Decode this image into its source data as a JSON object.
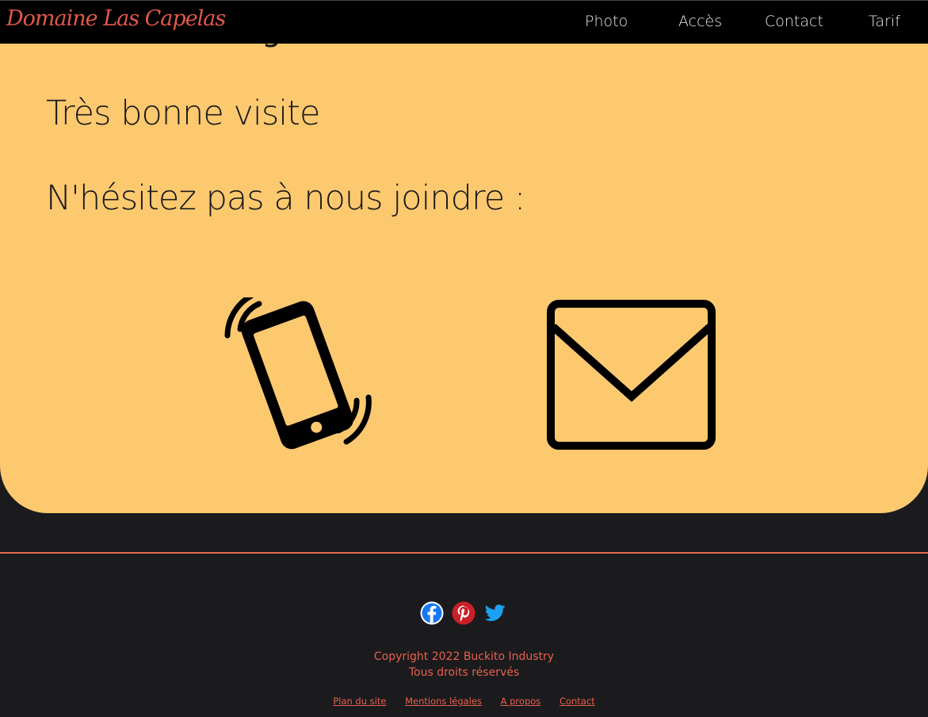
{
  "header": {
    "logo": "Domaine Las Capelas",
    "nav": [
      {
        "label": "Photo"
      },
      {
        "label": "Accès"
      },
      {
        "label": "Contact"
      },
      {
        "label": "Tarif"
      }
    ]
  },
  "content": {
    "line1": "Très bonne visite",
    "line2": "N'hésitez pas à nous joindre :",
    "icons": [
      "phone-vibrate-icon",
      "envelope-icon"
    ]
  },
  "footer": {
    "socials": [
      "facebook-icon",
      "pinterest-icon",
      "twitter-icon"
    ],
    "copyright_line1": "Copyright 2022 Buckito Industry",
    "copyright_line2": "Tous droits réservés",
    "links": [
      {
        "label": "Plan du site"
      },
      {
        "label": "Mentions légales"
      },
      {
        "label": "A propos"
      },
      {
        "label": "Contact"
      }
    ]
  },
  "colors": {
    "background": "#1b1b1e",
    "content_bg": "#fdc96f",
    "accent": "#e6604b",
    "header_bg": "#000000"
  }
}
